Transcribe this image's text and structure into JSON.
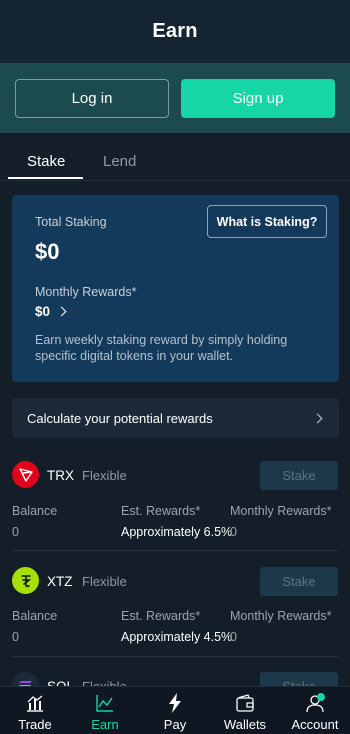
{
  "header": {
    "title": "Earn"
  },
  "auth": {
    "login_label": "Log in",
    "signup_label": "Sign up"
  },
  "tabs": [
    {
      "label": "Stake",
      "active": true
    },
    {
      "label": "Lend",
      "active": false
    }
  ],
  "staking_card": {
    "total_label": "Total Staking",
    "total_value": "$0",
    "what_button": "What is Staking?",
    "monthly_label": "Monthly Rewards*",
    "monthly_value": "$0",
    "description": "Earn weekly staking reward by simply holding specific digital tokens in your wallet."
  },
  "calculate": {
    "label": "Calculate your potential rewards"
  },
  "coins": [
    {
      "symbol": "TRX",
      "type": "Flexible",
      "stake_label": "Stake",
      "icon": "tron-icon",
      "color": "#e3001b",
      "balance_label": "Balance",
      "balance_value": "0",
      "rewards_label": "Est. Rewards*",
      "rewards_value": "Approximately 6.5%",
      "monthly_label": "Monthly Rewards*",
      "monthly_value": "0"
    },
    {
      "symbol": "XTZ",
      "type": "Flexible",
      "stake_label": "Stake",
      "icon": "tezos-icon",
      "color": "#a6e000",
      "balance_label": "Balance",
      "balance_value": "0",
      "rewards_label": "Est. Rewards*",
      "rewards_value": "Approximately 4.5%",
      "monthly_label": "Monthly Rewards*",
      "monthly_value": "0"
    },
    {
      "symbol": "SOL",
      "type": "Flexible",
      "stake_label": "Stake",
      "icon": "solana-icon"
    }
  ],
  "bottom_nav": [
    {
      "label": "Trade",
      "icon": "chart-bars-icon",
      "active": false
    },
    {
      "label": "Earn",
      "icon": "line-chart-icon",
      "active": true
    },
    {
      "label": "Pay",
      "icon": "lightning-icon",
      "active": false
    },
    {
      "label": "Wallets",
      "icon": "wallet-icon",
      "active": false
    },
    {
      "label": "Account",
      "icon": "person-icon",
      "active": false
    }
  ],
  "colors": {
    "accent": "#17d6a5",
    "card": "#143a5b",
    "auth_bar": "#1b4b4e"
  }
}
